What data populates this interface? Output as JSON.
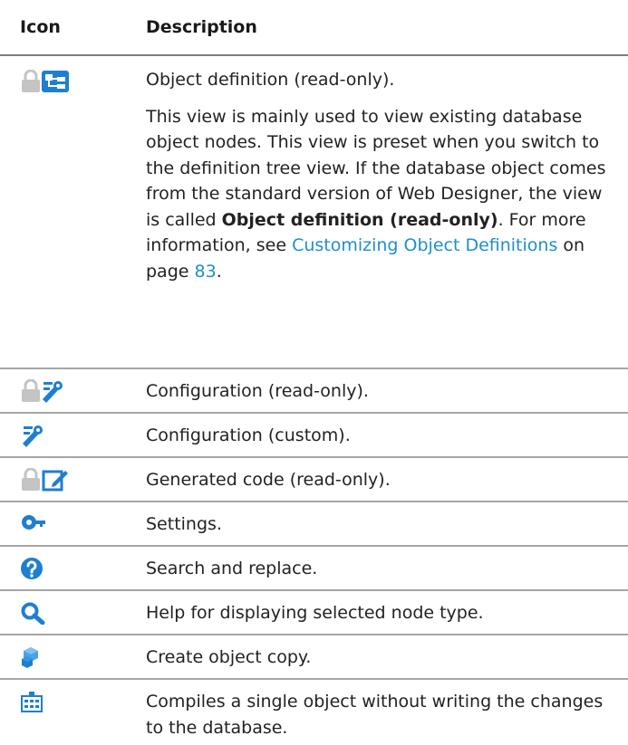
{
  "header": {
    "icon": "Icon",
    "description": "Description"
  },
  "rows": [
    {
      "icons": [
        "lock-icon",
        "object-definition-icon"
      ],
      "description": "Object definition (read-only).",
      "details": {
        "text1": "This view is mainly used to view existing database object nodes. This view is preset when you switch to the definition tree view. If the database object comes from the standard version of Web Designer, the view is called ",
        "bold": "Object definition (read-only)",
        "text2": ". For more information, see ",
        "link": "Customizing Object Definitions",
        "text3": " on page ",
        "page_link": "83",
        "text4": "."
      }
    },
    {
      "icons": [
        "lock-icon",
        "configuration-icon"
      ],
      "description": "Configuration (read-only)."
    },
    {
      "icons": [
        "configuration-icon"
      ],
      "description": "Configuration (custom)."
    },
    {
      "icons": [
        "lock-icon",
        "edit-code-icon"
      ],
      "description": "Generated code (read-only)."
    },
    {
      "icons": [
        "settings-key-icon"
      ],
      "description": "Settings."
    },
    {
      "icons": [
        "question-icon"
      ],
      "description": "Search and replace."
    },
    {
      "icons": [
        "search-icon"
      ],
      "description": "Help for displaying selected node type."
    },
    {
      "icons": [
        "copy-cubes-icon"
      ],
      "description": "Create object copy."
    },
    {
      "icons": [
        "compile-icon"
      ],
      "description": "Compiles a single object without writing the changes to the database."
    }
  ],
  "colors": {
    "accent": "#1f8fcb",
    "icon_blue": "#1e7fd0",
    "lock_gray": "#c4c4c4",
    "divider": "#a6a6a6"
  }
}
